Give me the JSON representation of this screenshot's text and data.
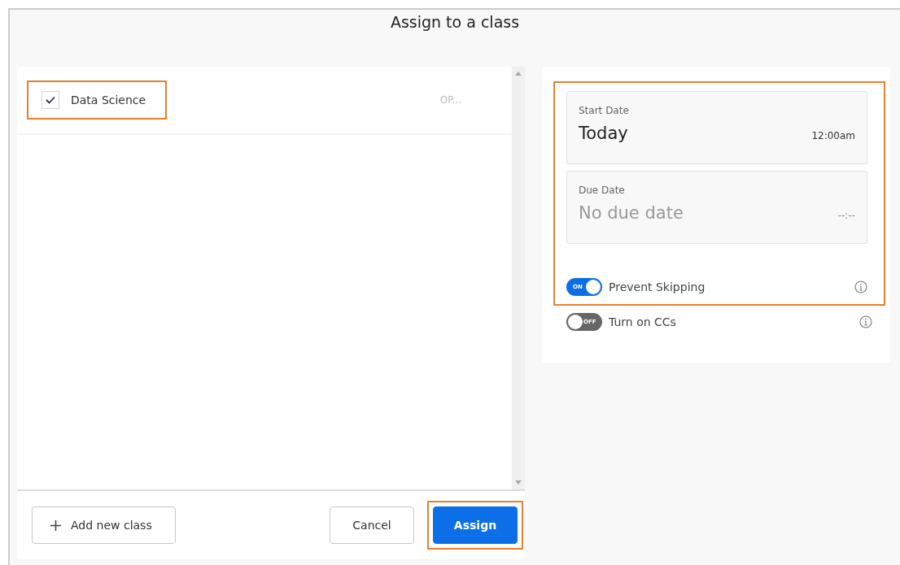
{
  "dialog": {
    "title": "Assign to a class"
  },
  "classes": [
    {
      "name": "Data Science",
      "checked": true,
      "column_2": "OP..."
    }
  ],
  "footer": {
    "add_button": "Add new class",
    "cancel_button": "Cancel",
    "assign_button": "Assign"
  },
  "dates": [
    {
      "label": "Start Date",
      "value": "Today",
      "time": "12:00am"
    },
    {
      "label": "Due Date",
      "placeholder": "No due date",
      "time": "--:--"
    }
  ],
  "toggles": [
    {
      "label": "Prevent Skipping",
      "on": true,
      "state_text": "ON"
    },
    {
      "label": "Turn on CCs",
      "on": false,
      "state_text": "OFF"
    }
  ]
}
